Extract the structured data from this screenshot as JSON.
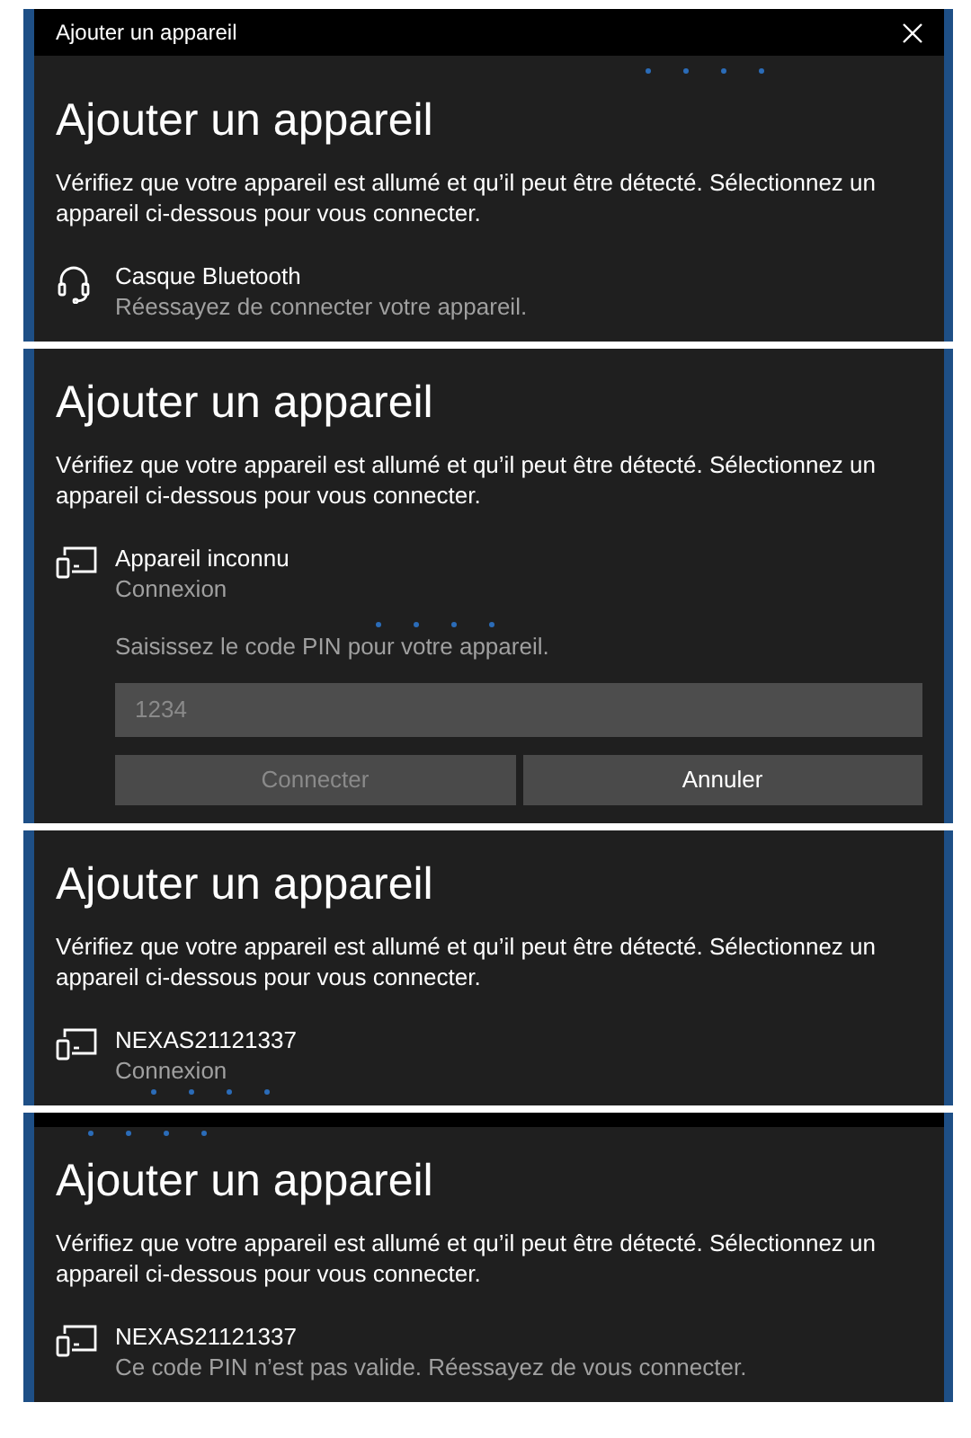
{
  "panels": [
    {
      "window_title": "Ajouter un appareil",
      "heading": "Ajouter un appareil",
      "description": "Vérifiez que votre appareil est allumé et qu’il peut être détecté. Sélectionnez un appareil ci-dessous pour vous connecter.",
      "device": {
        "kind": "headset",
        "name": "Casque Bluetooth",
        "status": "Réessayez de connecter votre appareil."
      }
    },
    {
      "heading": "Ajouter un appareil",
      "description": "Vérifiez que votre appareil est allumé et qu’il peut être détecté. Sélectionnez un appareil ci-dessous pour vous connecter.",
      "device": {
        "kind": "display",
        "name": "Appareil inconnu",
        "status": "Connexion"
      },
      "pin_prompt": "Saisissez le code PIN pour votre appareil.",
      "pin_field": {
        "placeholder": "1234"
      },
      "buttons": [
        {
          "label": "Connecter",
          "disabled": true
        },
        {
          "label": "Annuler",
          "disabled": false
        }
      ]
    },
    {
      "heading": "Ajouter un appareil",
      "description": "Vérifiez que votre appareil est allumé et qu’il peut être détecté. Sélectionnez un appareil ci-dessous pour vous connecter.",
      "device": {
        "kind": "display",
        "name": "NEXAS21121337",
        "status": "Connexion"
      }
    },
    {
      "heading": "Ajouter un appareil",
      "description": "Vérifiez que votre appareil est allumé et qu’il peut être détecté. Sélectionnez un appareil ci-dessous pour vous connecter.",
      "device": {
        "kind": "display",
        "name": "NEXAS21121337",
        "status": "Ce code PIN n’est pas valide. Réessayez de vous connecter."
      }
    }
  ]
}
